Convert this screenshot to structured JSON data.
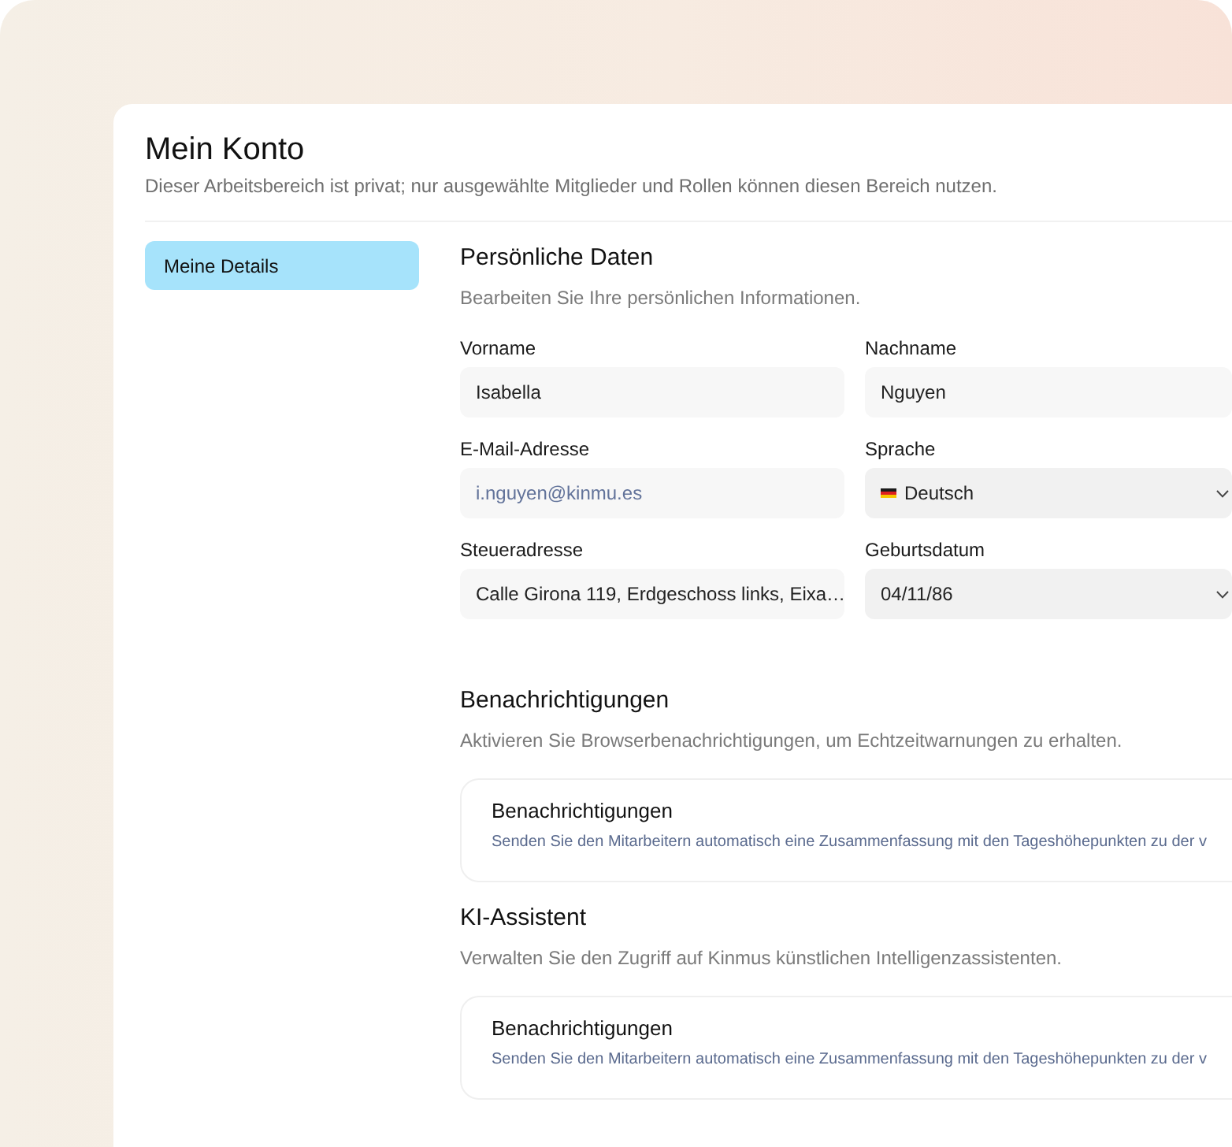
{
  "page": {
    "title": "Mein Konto",
    "subtitle": "Dieser Arbeitsbereich ist privat; nur ausgewählte Mitglieder und Rollen können diesen Bereich nutzen."
  },
  "sidebar": {
    "items": [
      {
        "label": "Meine Details",
        "selected": true
      }
    ]
  },
  "sections": [
    {
      "kind": "form",
      "title": "Persönliche Daten",
      "description": "Bearbeiten Sie Ihre persönlichen Informationen.",
      "fields": [
        {
          "kind": "text",
          "label": "Vorname",
          "value": "Isabella",
          "disabled": false
        },
        {
          "kind": "text",
          "label": "Nachname",
          "value": "Nguyen",
          "disabled": false
        },
        {
          "kind": "text",
          "label": "E-Mail-Adresse",
          "value": "i.nguyen@kinmu.es",
          "disabled": true
        },
        {
          "kind": "language",
          "label": "Sprache",
          "value": "Deutsch",
          "disabled": false
        },
        {
          "kind": "text",
          "label": "Steueradresse",
          "value": "Calle Girona 119, Erdgeschoss links, Eixa…",
          "disabled": false
        },
        {
          "kind": "select",
          "label": "Geburtsdatum",
          "value": "04/11/86",
          "disabled": false
        }
      ]
    },
    {
      "kind": "cards",
      "title": "Benachrichtigungen",
      "description": "Aktivieren Sie Browserbenachrichtigungen, um Echtzeitwarnungen zu erhalten.",
      "cards": [
        {
          "title": "Benachrichtigungen",
          "description": "Senden Sie den Mitarbeitern automatisch eine Zusammenfassung mit den Tageshöhepunkten zu der v"
        }
      ]
    },
    {
      "kind": "cards",
      "title": "KI-Assistent",
      "description": "Verwalten Sie den Zugriff auf Kinmus künstlichen Intelligenzassistenten.",
      "cards": [
        {
          "title": "Benachrichtigungen",
          "description": "Senden Sie den Mitarbeitern automatisch eine Zusammenfassung mit den Tageshöhepunkten zu der v"
        }
      ]
    }
  ]
}
